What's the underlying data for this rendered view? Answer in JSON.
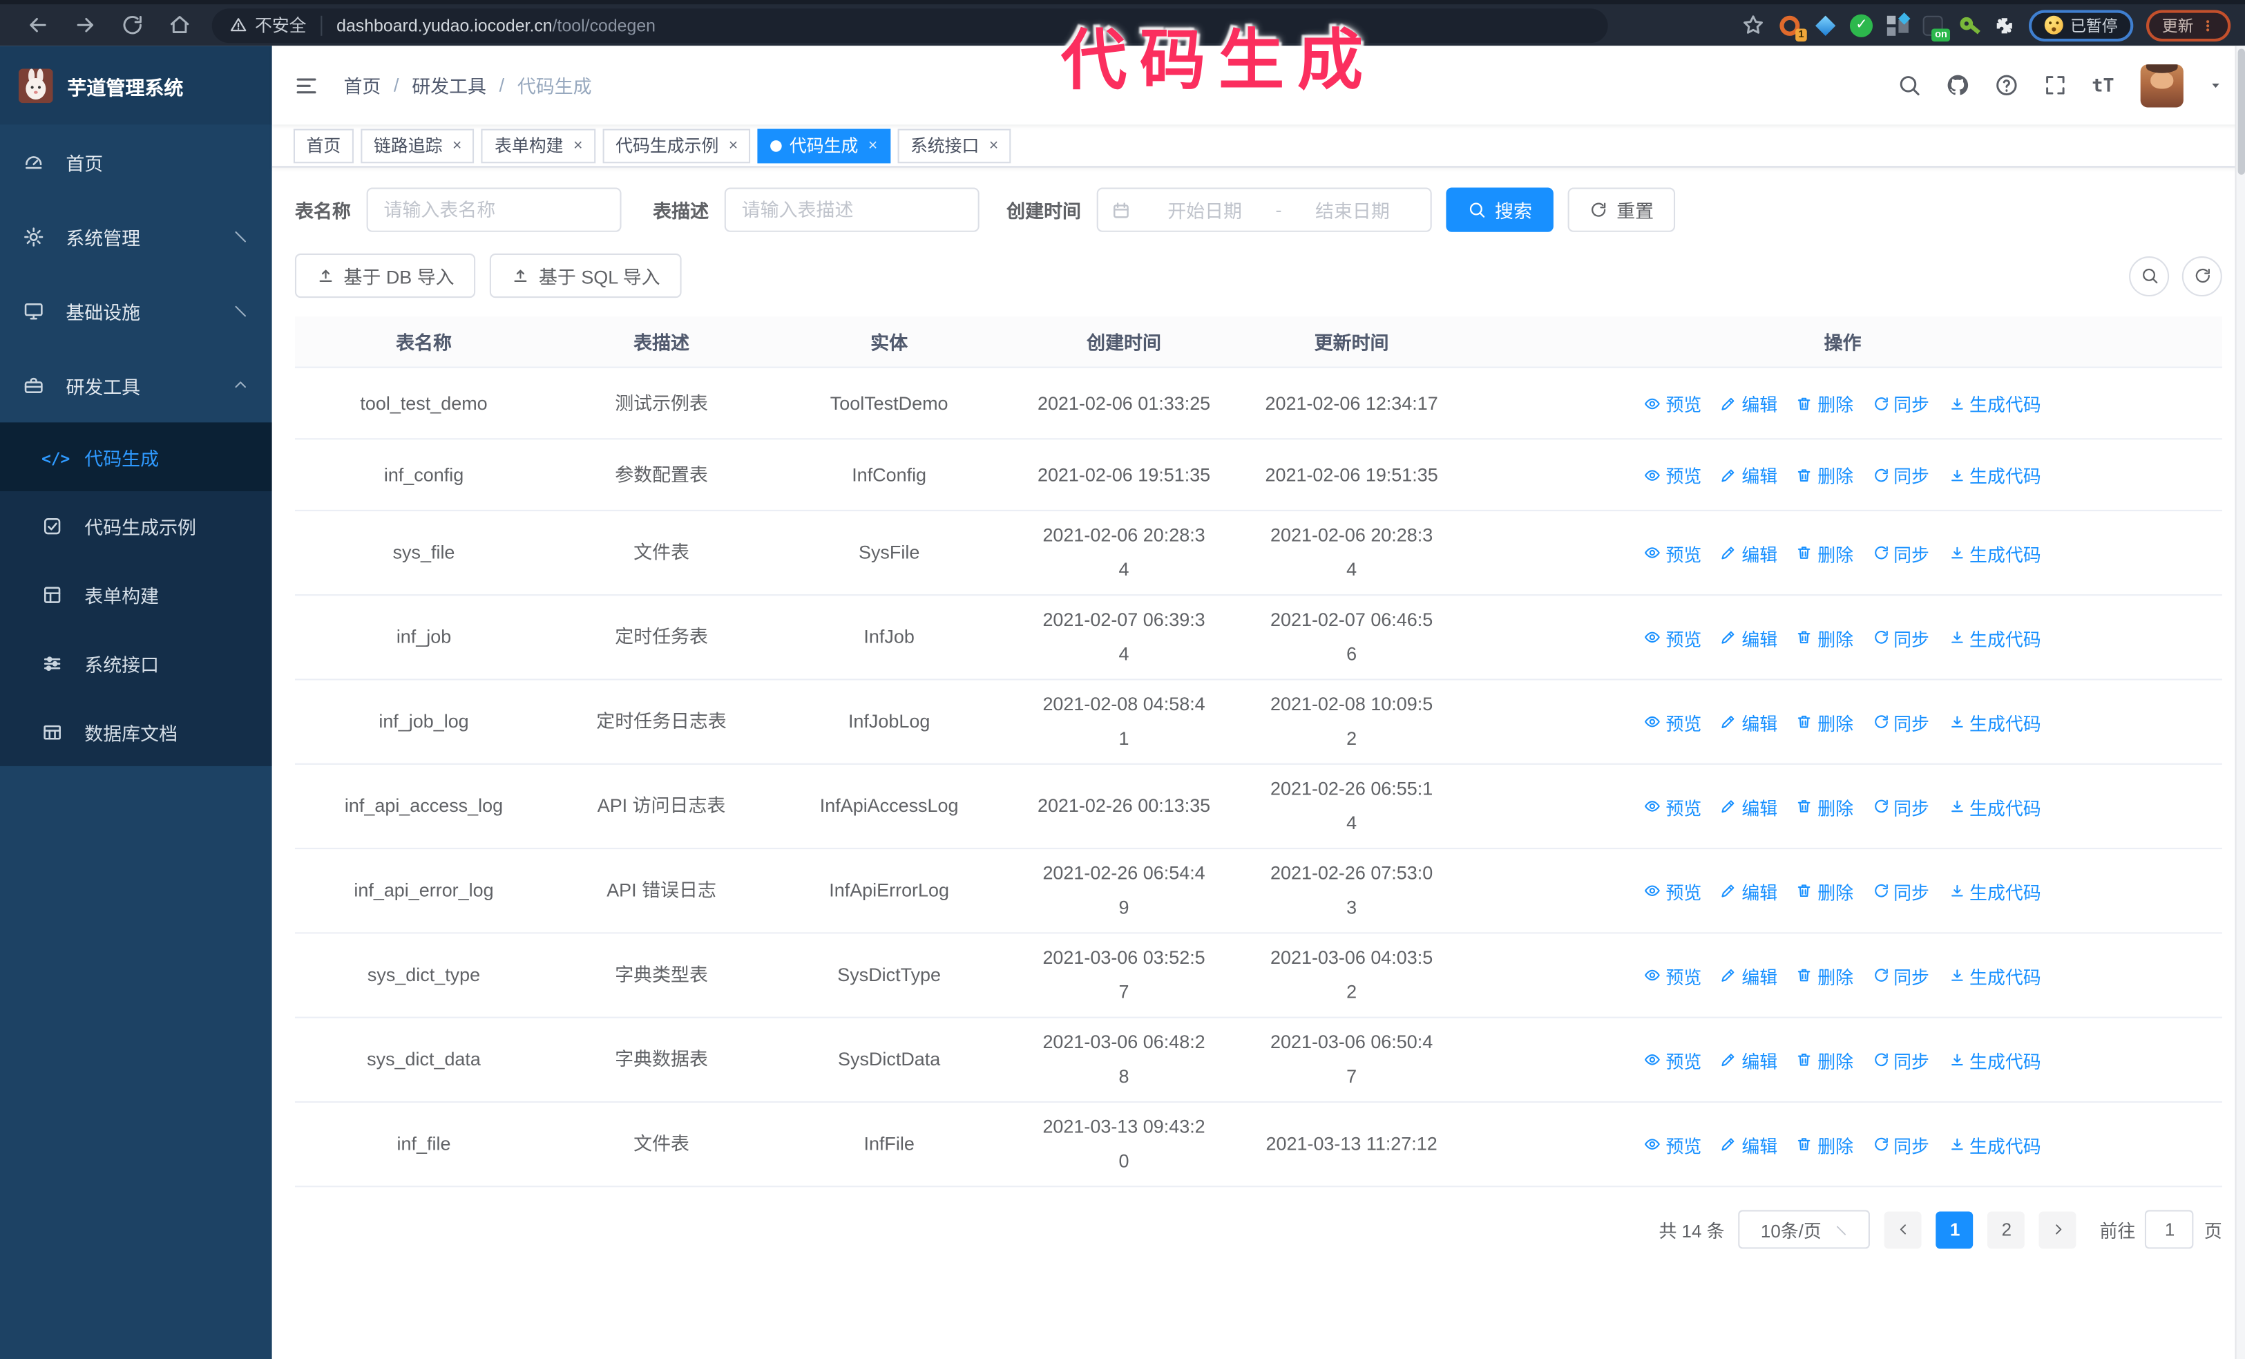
{
  "browser": {
    "security_warning": "不安全",
    "url_host": "dashboard.yudao.iocoder.cn",
    "url_path": "/tool/codegen",
    "extension_badge": "1",
    "extension_on_badge": "on",
    "profile_badge": "已暂停",
    "update_button": "更新"
  },
  "annotation": {
    "text": "代码生成",
    "color": "#fb2e5e"
  },
  "sidebar": {
    "logo_title": "芋道管理系统",
    "items": [
      {
        "key": "home",
        "label": "首页",
        "icon": "gauge-icon",
        "expandable": false,
        "expanded": false
      },
      {
        "key": "system",
        "label": "系统管理",
        "icon": "gear-icon",
        "expandable": true,
        "expanded": false
      },
      {
        "key": "infra",
        "label": "基础设施",
        "icon": "monitor-icon",
        "expandable": true,
        "expanded": false
      },
      {
        "key": "devtools",
        "label": "研发工具",
        "icon": "toolbox-icon",
        "expandable": true,
        "expanded": true
      }
    ],
    "submenu": [
      {
        "key": "codegen",
        "label": "代码生成",
        "icon": "code-icon",
        "active": true
      },
      {
        "key": "codegen-example",
        "label": "代码生成示例",
        "icon": "example-icon",
        "active": false
      },
      {
        "key": "form-build",
        "label": "表单构建",
        "icon": "form-icon",
        "active": false
      },
      {
        "key": "system-api",
        "label": "系统接口",
        "icon": "sliders-icon",
        "active": false
      },
      {
        "key": "db-doc",
        "label": "数据库文档",
        "icon": "database-icon",
        "active": false
      }
    ]
  },
  "header": {
    "breadcrumb": [
      "首页",
      "研发工具",
      "代码生成"
    ],
    "breadcrumb_separator": "/"
  },
  "tabs": [
    {
      "label": "首页",
      "closable": false,
      "active": false
    },
    {
      "label": "链路追踪",
      "closable": true,
      "active": false
    },
    {
      "label": "表单构建",
      "closable": true,
      "active": false
    },
    {
      "label": "代码生成示例",
      "closable": true,
      "active": false
    },
    {
      "label": "代码生成",
      "closable": true,
      "active": true
    },
    {
      "label": "系统接口",
      "closable": true,
      "active": false
    }
  ],
  "filters": {
    "table_name_label": "表名称",
    "table_name_placeholder": "请输入表名称",
    "table_desc_label": "表描述",
    "table_desc_placeholder": "请输入表描述",
    "create_time_label": "创建时间",
    "date_start_placeholder": "开始日期",
    "date_separator": "-",
    "date_end_placeholder": "结束日期",
    "search_label": "搜索",
    "reset_label": "重置"
  },
  "toolbar": {
    "import_db_label": "基于 DB 导入",
    "import_sql_label": "基于 SQL 导入"
  },
  "table": {
    "columns": [
      "表名称",
      "表描述",
      "实体",
      "创建时间",
      "更新时间",
      "操作"
    ],
    "actions": [
      {
        "label": "预览",
        "icon": "eye-icon"
      },
      {
        "label": "编辑",
        "icon": "edit-icon"
      },
      {
        "label": "删除",
        "icon": "delete-icon"
      },
      {
        "label": "同步",
        "icon": "sync-icon"
      },
      {
        "label": "生成代码",
        "icon": "download-icon"
      }
    ],
    "rows": [
      {
        "name": "tool_test_demo",
        "desc": "测试示例表",
        "entity": "ToolTestDemo",
        "created": "2021-02-06 01:33:25",
        "updated": "2021-02-06 12:34:17"
      },
      {
        "name": "inf_config",
        "desc": "参数配置表",
        "entity": "InfConfig",
        "created": "2021-02-06 19:51:35",
        "updated": "2021-02-06 19:51:35"
      },
      {
        "name": "sys_file",
        "desc": "文件表",
        "entity": "SysFile",
        "created": "2021-02-06 20:28:3\n4",
        "updated": "2021-02-06 20:28:3\n4"
      },
      {
        "name": "inf_job",
        "desc": "定时任务表",
        "entity": "InfJob",
        "created": "2021-02-07 06:39:3\n4",
        "updated": "2021-02-07 06:46:5\n6"
      },
      {
        "name": "inf_job_log",
        "desc": "定时任务日志表",
        "entity": "InfJobLog",
        "created": "2021-02-08 04:58:4\n1",
        "updated": "2021-02-08 10:09:5\n2"
      },
      {
        "name": "inf_api_access_log",
        "desc": "API 访问日志表",
        "entity": "InfApiAccessLog",
        "created": "2021-02-26 00:13:35",
        "updated": "2021-02-26 06:55:1\n4"
      },
      {
        "name": "inf_api_error_log",
        "desc": "API 错误日志",
        "entity": "InfApiErrorLog",
        "created": "2021-02-26 06:54:4\n9",
        "updated": "2021-02-26 07:53:0\n3"
      },
      {
        "name": "sys_dict_type",
        "desc": "字典类型表",
        "entity": "SysDictType",
        "created": "2021-03-06 03:52:5\n7",
        "updated": "2021-03-06 04:03:5\n2"
      },
      {
        "name": "sys_dict_data",
        "desc": "字典数据表",
        "entity": "SysDictData",
        "created": "2021-03-06 06:48:2\n8",
        "updated": "2021-03-06 06:50:4\n7"
      },
      {
        "name": "inf_file",
        "desc": "文件表",
        "entity": "InfFile",
        "created": "2021-03-13 09:43:2\n0",
        "updated": "2021-03-13 11:27:12"
      }
    ]
  },
  "pagination": {
    "total_label": "共 14 条",
    "page_size": "10条/页",
    "pages": [
      "1",
      "2"
    ],
    "active_page": "1",
    "goto_label": "前往",
    "goto_value": "1",
    "goto_suffix": "页"
  },
  "colors": {
    "primary": "#1890ff",
    "annotation": "#fb2e5e",
    "sidebar_bg": "#1d4264",
    "submenu_bg": "#142e49",
    "active_item_bg": "#0b2135"
  }
}
